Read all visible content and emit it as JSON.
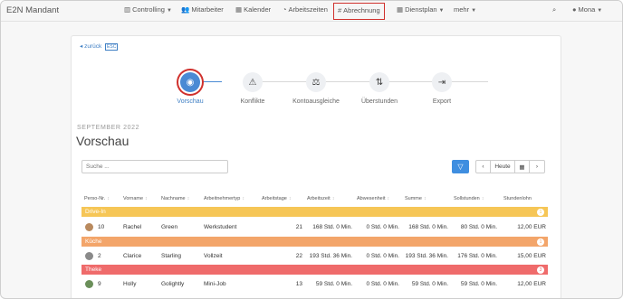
{
  "brand": "E2N Mandant",
  "nav": {
    "controlling": "Controlling",
    "mitarbeiter": "Mitarbeiter",
    "kalender": "Kalender",
    "arbeitszeiten": "Arbeitszeiten",
    "abrechnung": "Abrechnung",
    "dienstplan": "Dienstplan",
    "mehr": "mehr",
    "user": "Mona"
  },
  "back": {
    "label": "zurück",
    "tag": "ESC"
  },
  "steps": [
    "Vorschau",
    "Konflikte",
    "Kontoausgleiche",
    "Überstunden",
    "Export"
  ],
  "month": "SEPTEMBER 2022",
  "title": "Vorschau",
  "search_placeholder": "Suche ...",
  "today": "Heute",
  "columns": [
    "Perso-Nr.",
    "Vorname",
    "Nachname",
    "Arbeitnehmertyp",
    "Arbeitstage",
    "Arbeitszeit",
    "Abwesenheit",
    "Summe",
    "Sollstunden",
    "Stundenlohn"
  ],
  "groups": [
    {
      "name": "Drive-In",
      "count": "1",
      "color": "#f6c656"
    },
    {
      "name": "Küche",
      "count": "1",
      "color": "#f3a56a"
    },
    {
      "name": "Theke",
      "count": "3",
      "color": "#ef6b6b"
    }
  ],
  "rows": [
    {
      "nr": "10",
      "vorname": "Rachel",
      "nachname": "Green",
      "typ": "Werkstudent",
      "tage": "21",
      "zeit": "168 Std. 0 Min.",
      "abw": "0 Std. 0 Min.",
      "summe": "168 Std. 0 Min.",
      "soll": "80 Std. 0 Min.",
      "lohn": "12,00 EUR"
    },
    {
      "nr": "2",
      "vorname": "Clarice",
      "nachname": "Starling",
      "typ": "Vollzeit",
      "tage": "22",
      "zeit": "193 Std. 36 Min.",
      "abw": "0 Std. 0 Min.",
      "summe": "193 Std. 36 Min.",
      "soll": "176 Std. 0 Min.",
      "lohn": "15,00 EUR"
    },
    {
      "nr": "9",
      "vorname": "Holly",
      "nachname": "Golightly",
      "typ": "Mini-Job",
      "tage": "13",
      "zeit": "59 Std. 0 Min.",
      "abw": "0 Std. 0 Min.",
      "summe": "59 Std. 0 Min.",
      "soll": "59 Std. 0 Min.",
      "lohn": "12,00 EUR"
    }
  ],
  "colors": {
    "accent": "#3f8ee0",
    "highlight": "#d0312d"
  }
}
